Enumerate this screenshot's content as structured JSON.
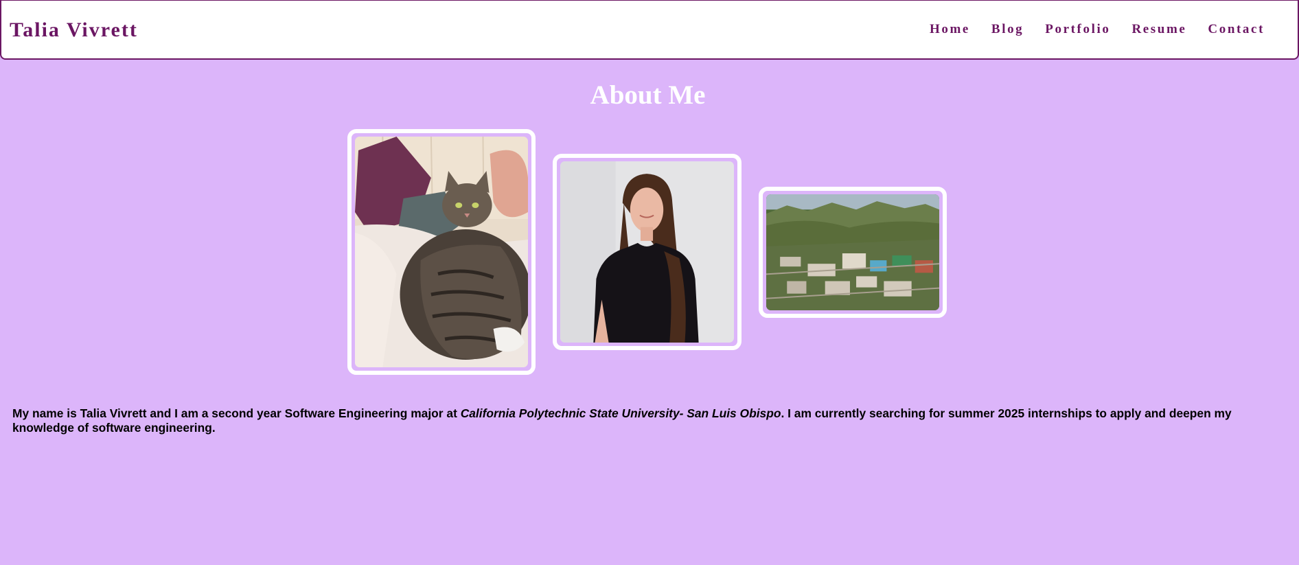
{
  "site": {
    "brand": "Talia Vivrett",
    "colors": {
      "background": "#dcb5fa",
      "accent": "#6b1663",
      "frame": "#ffffff"
    }
  },
  "nav": {
    "items": [
      {
        "label": "Home"
      },
      {
        "label": "Blog"
      },
      {
        "label": "Portfolio"
      },
      {
        "label": "Resume"
      },
      {
        "label": "Contact"
      }
    ]
  },
  "main": {
    "title": "About Me",
    "photos": [
      {
        "subject": "tabby cat on bed with pillows"
      },
      {
        "subject": "portrait of woman in black top"
      },
      {
        "subject": "aerial view of university campus and hills"
      }
    ],
    "bio": {
      "intro": "My name is Talia Vivrett and I am a second year Software Engineering major at ",
      "school": "California Polytechnic State University- San Luis Obispo",
      "outro": ". I am currently searching for summer 2025 internships to apply and deepen my knowledge of software engineering."
    }
  }
}
